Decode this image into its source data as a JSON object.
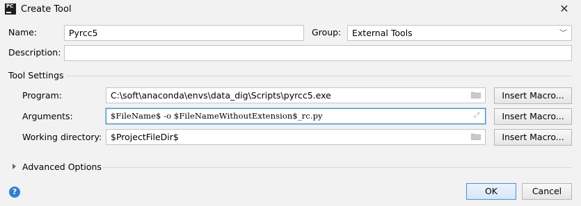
{
  "window": {
    "title": "Create Tool",
    "app_icon_text": "PC",
    "close_label": "✕"
  },
  "form": {
    "name_label": "Name:",
    "name_value": "Pyrcc5",
    "group_label": "Group:",
    "group_value": "External Tools",
    "description_label": "Description:",
    "description_value": ""
  },
  "tool_settings": {
    "section_title": "Tool Settings",
    "program_label": "Program:",
    "program_value": "C:\\soft\\anaconda\\envs\\data_dig\\Scripts\\pyrcc5.exe",
    "arguments_label": "Arguments:",
    "arguments_value": "$FileName$ -o $FileNameWithoutExtension$_rc.py",
    "working_dir_label": "Working directory:",
    "working_dir_value": "$ProjectFileDir$",
    "insert_macro_label": "Insert Macro..."
  },
  "advanced": {
    "label": "Advanced Options"
  },
  "footer": {
    "ok_label": "OK",
    "cancel_label": "Cancel",
    "help_label": "?"
  },
  "colors": {
    "focus_border": "#3d8fd6",
    "help_icon": "#2f7fd9",
    "dialog_bg": "#f2f2f2"
  }
}
